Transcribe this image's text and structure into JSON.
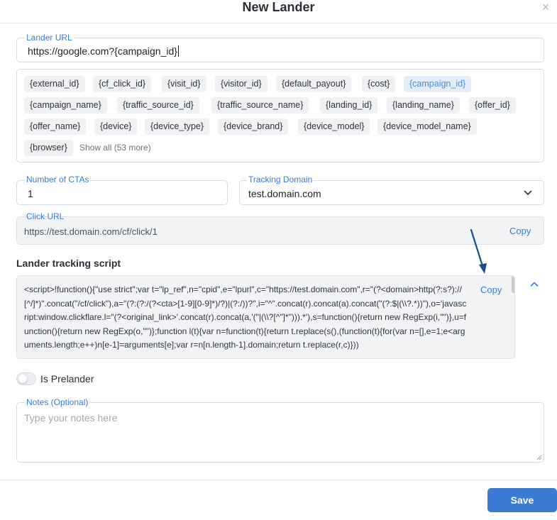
{
  "modal": {
    "title": "New Lander",
    "close_symbol": "×"
  },
  "lander_url": {
    "label": "Lander URL",
    "value": "https://google.com?{campaign_id}"
  },
  "tokens": {
    "items": [
      {
        "label": "{external_id}",
        "active": false
      },
      {
        "label": "{cf_click_id}",
        "active": false
      },
      {
        "label": "{visit_id}",
        "active": false
      },
      {
        "label": "{visitor_id}",
        "active": false
      },
      {
        "label": "{default_payout}",
        "active": false
      },
      {
        "label": "{cost}",
        "active": false
      },
      {
        "label": "{campaign_id}",
        "active": true
      },
      {
        "label": "{campaign_name}",
        "active": false
      },
      {
        "label": "{traffic_source_id}",
        "active": false
      },
      {
        "label": "{traffic_source_name}",
        "active": false
      },
      {
        "label": "{landing_id}",
        "active": false
      },
      {
        "label": "{landing_name}",
        "active": false
      },
      {
        "label": "{offer_id}",
        "active": false
      },
      {
        "label": "{offer_name}",
        "active": false
      },
      {
        "label": "{device}",
        "active": false
      },
      {
        "label": "{device_type}",
        "active": false
      },
      {
        "label": "{device_brand}",
        "active": false
      },
      {
        "label": "{device_model}",
        "active": false
      },
      {
        "label": "{device_model_name}",
        "active": false
      },
      {
        "label": "{browser}",
        "active": false
      }
    ],
    "show_all": "Show all (53 more)"
  },
  "ctas": {
    "label": "Number of CTAs",
    "value": "1"
  },
  "tracking_domain": {
    "label": "Tracking Domain",
    "value": "test.domain.com",
    "icon": "chevron-down-icon"
  },
  "click_url": {
    "label": "Click URL",
    "value": "https://test.domain.com/cf/click/1",
    "copy_label": "Copy"
  },
  "tracking_script": {
    "title": "Lander tracking script",
    "copy_label": "Copy",
    "code": "<script>!function(){\"use strict\";var t=\"lp_ref\",n=\"cpid\",e=\"lpurl\",c=\"https://test.domain.com\",r=\"(?<domain>http(?:s?)://[^/]*)\".concat(\"/cf/click\"),a=\"(?:(?:/(?<cta>[1-9][0-9]*)/?)|(?:/))?\",i=\"^\".concat(r).concat(a).concat(\"(?:$|(\\\\?.*))\"),o='javascript:window.clickflare.l=\"(?<original_link>'.concat(r).concat(a,'(\"|(\\\\?[^\"]*\"))).*'),s=function(){return new RegExp(i,\"\")},u=function(){return new RegExp(o,\"\")};function l(t){var n=function(t){return t.replace(s(),(function(t){for(var n=[],e=1;e<arguments.length;e++)n[e-1]=arguments[e];var r=n[n.length-1].domain;return t.replace(r,c)}))",
    "collapse_icon": "chevron-up-icon"
  },
  "prelander": {
    "label": "Is Prelander",
    "checked": false
  },
  "notes": {
    "label": "Notes (Optional)",
    "placeholder": "Type your notes here"
  },
  "footer": {
    "save_label": "Save"
  },
  "colors": {
    "accent": "#3a7bd5",
    "token_bg": "#f0f1f3",
    "token_active_bg": "#e3eefc",
    "arrow": "#1a4f86"
  }
}
